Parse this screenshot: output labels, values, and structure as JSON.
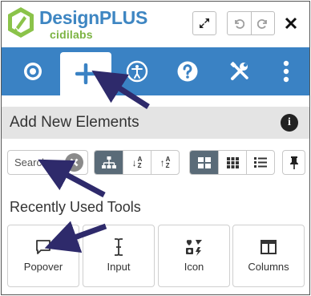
{
  "header": {
    "brand_name": "DesignPLUS",
    "brand_sub": "cidilabs",
    "brand_color": "#3e86c2",
    "brand_sub_color": "#7cb342",
    "icons": [
      "expand-icon",
      "undo-icon",
      "redo-icon",
      "close-icon"
    ]
  },
  "toolbar": {
    "background": "#3a82c4",
    "active_tab": "add",
    "tools": [
      {
        "name": "target-icon"
      },
      {
        "name": "plus-icon"
      },
      {
        "name": "accessibility-icon"
      },
      {
        "name": "help-icon"
      },
      {
        "name": "tools-icon"
      },
      {
        "name": "more-vertical-icon"
      }
    ]
  },
  "section": {
    "title": "Add New Elements",
    "info_icon": "i"
  },
  "controls": {
    "search_placeholder": "Search",
    "sort_group": [
      "hierarchy-icon",
      "sort-ascending-icon",
      "sort-descending-icon"
    ],
    "sort_asc_label": "↓",
    "sort_desc_label": "↑",
    "view_group": [
      "large-grid-icon",
      "small-grid-icon",
      "list-icon"
    ],
    "pin_icon": "pin-icon"
  },
  "recent": {
    "title": "Recently Used Tools",
    "items": [
      {
        "label": "Popover",
        "icon": "comment-icon"
      },
      {
        "label": "Input",
        "icon": "text-cursor-icon"
      },
      {
        "label": "Icon",
        "icon": "icons-icon"
      },
      {
        "label": "Columns",
        "icon": "columns-icon"
      }
    ]
  },
  "annotation_color": "#2e2a6b"
}
